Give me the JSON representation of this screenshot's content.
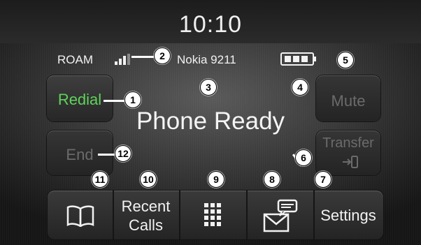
{
  "clock": "10:10",
  "status": {
    "roam": "ROAM",
    "device": "Nokia 9211"
  },
  "main": {
    "redial": "Redial",
    "mute": "Mute",
    "end": "End",
    "transfer": "Transfer",
    "message": "Phone Ready"
  },
  "bottom": {
    "recent_line1": "Recent",
    "recent_line2": "Calls",
    "settings": "Settings"
  },
  "callouts": [
    "1",
    "2",
    "3",
    "4",
    "5",
    "6",
    "7",
    "8",
    "9",
    "10",
    "11",
    "12"
  ],
  "colors": {
    "redial_green": "#5fd35a",
    "disabled": "#6b6b6b"
  },
  "icons": {
    "phonebook": "open-book-icon",
    "keypad": "keypad-grid-icon",
    "messaging": "envelope-message-icon",
    "signal": "signal-bars-icon",
    "battery": "battery-icon",
    "transfer": "phone-transfer-icon"
  }
}
